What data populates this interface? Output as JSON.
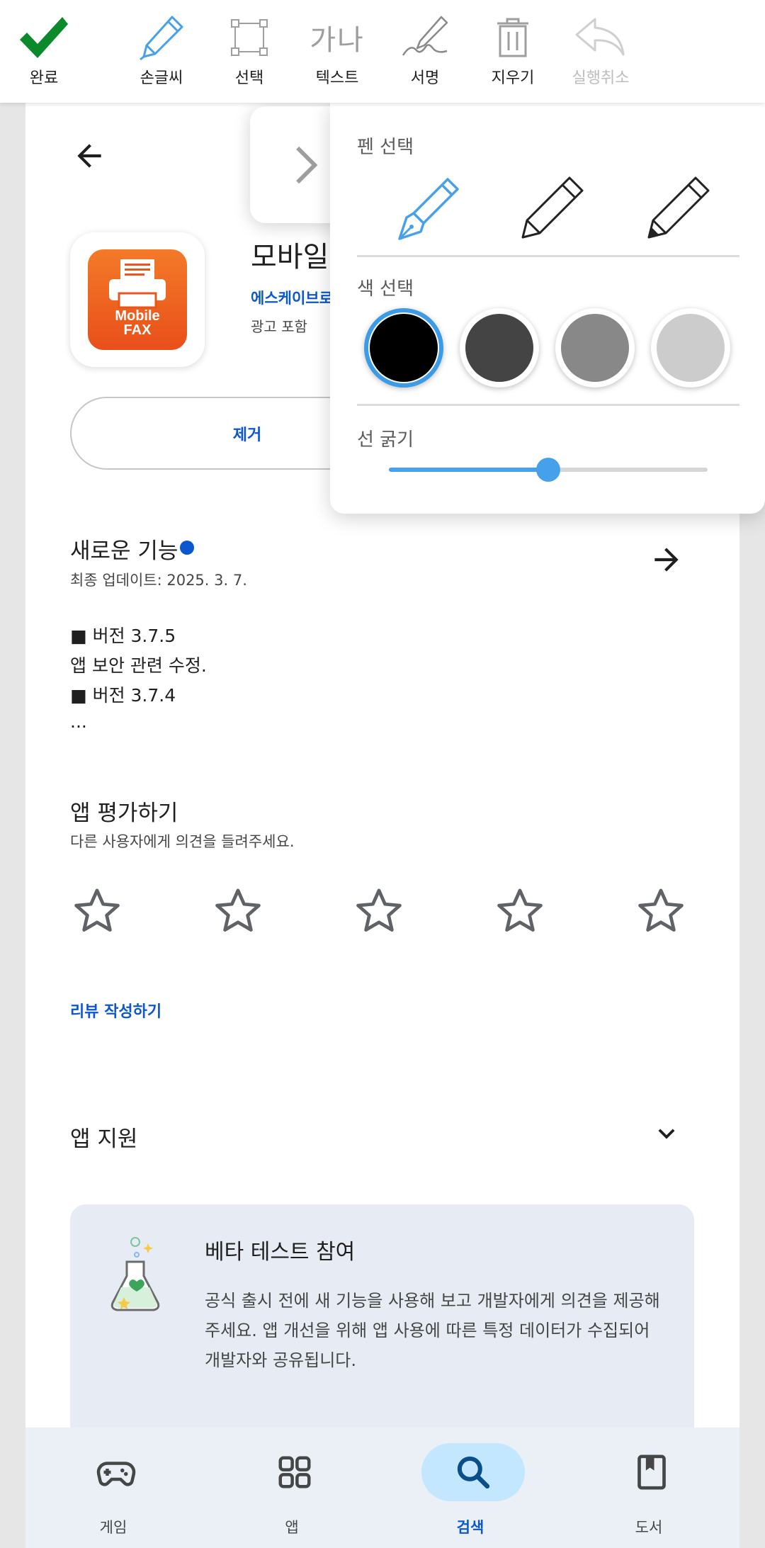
{
  "toolbar": {
    "tools": [
      {
        "label": "완료",
        "icon": "checkmark-icon"
      },
      {
        "label": "손글씨",
        "icon": "pen-icon"
      },
      {
        "label": "선택",
        "icon": "selection-icon"
      },
      {
        "label": "텍스트",
        "icon": "text-icon",
        "glyph": "가나"
      },
      {
        "label": "서명",
        "icon": "signature-icon"
      },
      {
        "label": "지우기",
        "icon": "trash-icon"
      },
      {
        "label": "실행취소",
        "icon": "undo-icon"
      }
    ]
  },
  "pen_panel": {
    "pen_label": "펜 선택",
    "color_label": "색 선택",
    "thickness_label": "선 굵기",
    "pens": [
      "fountain-pen",
      "pencil",
      "marker"
    ],
    "selected_pen": 0,
    "colors": [
      "#000000",
      "#444444",
      "#888888",
      "#cccccc"
    ],
    "selected_color": 0,
    "thickness": 0.5
  },
  "app": {
    "title": "모바일",
    "developer": "에스케이브로",
    "ads": "광고 포함",
    "icon_line1": "Mobile",
    "icon_line2": "FAX",
    "remove_label": "제거"
  },
  "whats_new": {
    "title": "새로운 기능",
    "updated": "최종 업데이트: 2025. 3. 7.",
    "lines": [
      "■ 버전 3.7.5",
      "앱 보안 관련 수정.",
      "■ 버전 3.7.4",
      "..."
    ]
  },
  "rate": {
    "title": "앱 평가하기",
    "subtitle": "다른 사용자에게 의견을 들려주세요.",
    "stars": 0,
    "max_stars": 5,
    "review_link": "리뷰 작성하기"
  },
  "support": {
    "title": "앱 지원"
  },
  "beta": {
    "title": "베타 테스트 참여",
    "body": "공식 출시 전에 새 기능을 사용해 보고 개발자에게 의견을 제공해 주세요. 앱 개선을 위해 앱 사용에 따른 특정 데이터가 수집되어 개발자와 공유됩니다."
  },
  "bottom_nav": {
    "items": [
      {
        "label": "게임",
        "icon": "gamepad-icon"
      },
      {
        "label": "앱",
        "icon": "apps-grid-icon"
      },
      {
        "label": "검색",
        "icon": "search-icon",
        "active": true
      },
      {
        "label": "도서",
        "icon": "book-icon"
      }
    ]
  },
  "colors": {
    "accent": "#0b57d0",
    "pen_blue": "#47a0ea",
    "check_green": "#0a8a2a"
  }
}
